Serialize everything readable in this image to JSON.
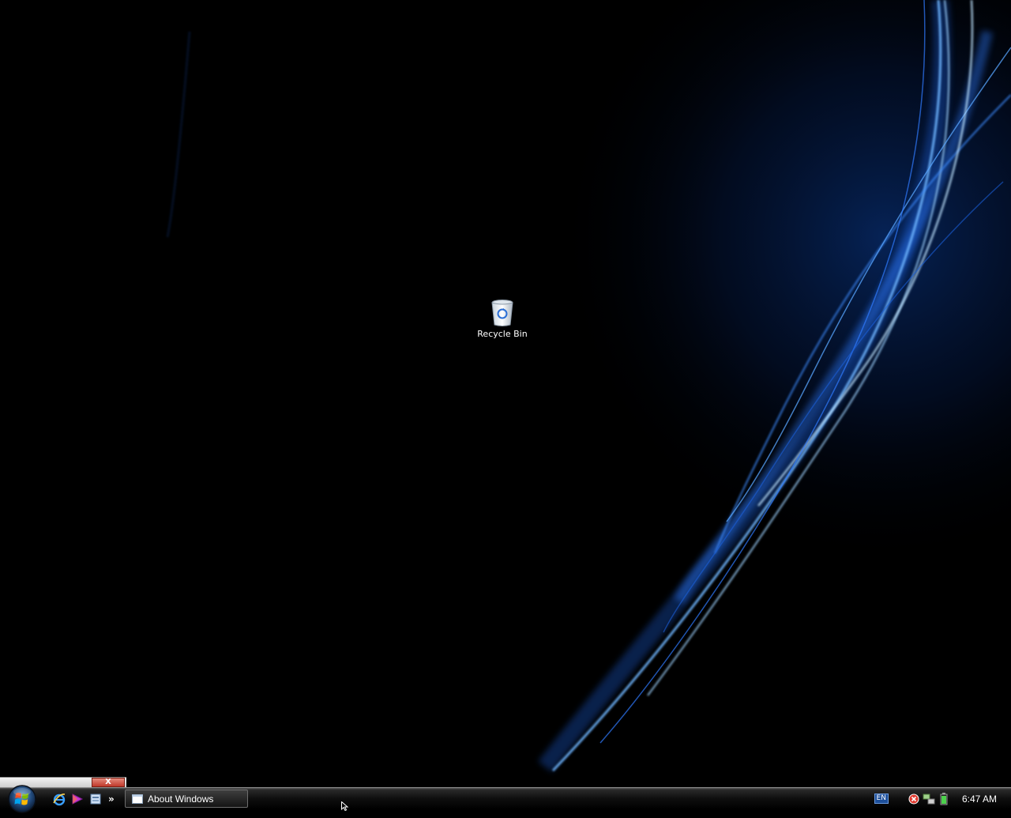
{
  "desktop": {
    "icons": [
      {
        "label": "Recycle Bin",
        "icon": "recycle-bin-icon"
      }
    ]
  },
  "mini_toolbar": {
    "close_label": "X"
  },
  "taskbar": {
    "start": {
      "icon": "windows-start-orb-icon"
    },
    "quick_launch": [
      {
        "icon": "internet-explorer-icon"
      },
      {
        "icon": "media-player-icon"
      },
      {
        "icon": "show-desktop-icon"
      }
    ],
    "quick_launch_overflow": "»",
    "tasks": [
      {
        "label": "About Windows",
        "icon": "window-icon"
      }
    ],
    "tray": {
      "language": "EN",
      "icons": [
        "security-alert-icon",
        "network-icon",
        "battery-icon"
      ],
      "clock": "6:47 AM"
    }
  },
  "colors": {
    "wallpaper_base": "#000000",
    "wallpaper_accent": "#1e6fff",
    "taskbar": "#0e0e0e"
  }
}
